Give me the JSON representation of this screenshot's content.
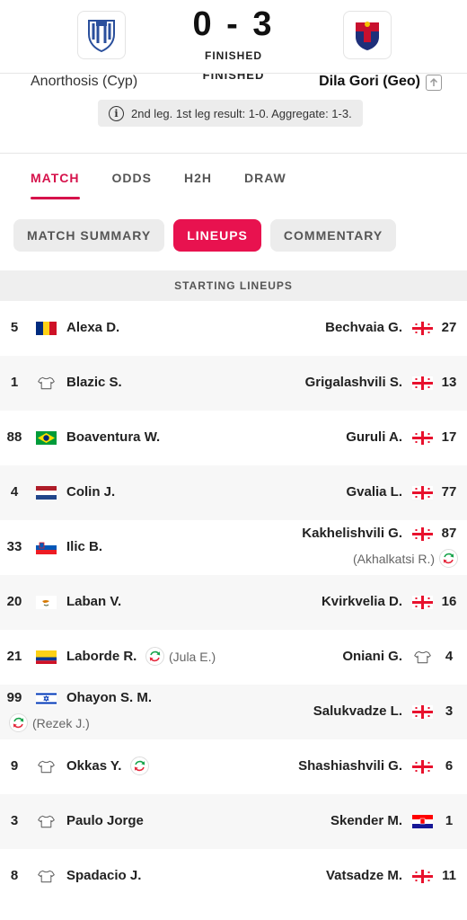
{
  "match": {
    "score": "0 - 3",
    "status": "FINISHED",
    "home_team": "Anorthosis (Cyp)",
    "away_team": "Dila Gori (Geo)",
    "info": "2nd leg. 1st leg result: 1-0. Aggregate: 1-3."
  },
  "tabs": [
    "MATCH",
    "ODDS",
    "H2H",
    "DRAW"
  ],
  "subtabs": [
    "MATCH SUMMARY",
    "LINEUPS",
    "COMMENTARY"
  ],
  "section_title": "STARTING LINEUPS",
  "colors": {
    "accent": "#d6124b",
    "accent_bg": "#e8124f",
    "row_alt": "#f7f7f7"
  },
  "home_lineup": [
    {
      "number": "5",
      "name": "Alexa D.",
      "flag": "romania-flag"
    },
    {
      "number": "1",
      "name": "Blazic S.",
      "flag": "jersey-icon"
    },
    {
      "number": "88",
      "name": "Boaventura W.",
      "flag": "brazil-flag"
    },
    {
      "number": "4",
      "name": "Colin J.",
      "flag": "netherlands-flag"
    },
    {
      "number": "33",
      "name": "Ilic B.",
      "flag": "slovenia-flag"
    },
    {
      "number": "20",
      "name": "Laban V.",
      "flag": "cyprus-flag"
    },
    {
      "number": "21",
      "name": "Laborde R.",
      "flag": "colombia-flag",
      "sub": "(Jula E.)"
    },
    {
      "number": "99",
      "name": "Ohayon S. M.",
      "flag": "israel-flag",
      "sub": "(Rezek J.)"
    },
    {
      "number": "9",
      "name": "Okkas Y.",
      "flag": "jersey-icon",
      "swap": true
    },
    {
      "number": "3",
      "name": "Paulo Jorge",
      "flag": "jersey-icon"
    },
    {
      "number": "8",
      "name": "Spadacio J.",
      "flag": "jersey-icon"
    }
  ],
  "away_lineup": [
    {
      "number": "27",
      "name": "Bechvaia G.",
      "flag": "georgia-flag"
    },
    {
      "number": "13",
      "name": "Grigalashvili S.",
      "flag": "georgia-flag"
    },
    {
      "number": "17",
      "name": "Guruli A.",
      "flag": "georgia-flag"
    },
    {
      "number": "77",
      "name": "Gvalia L.",
      "flag": "georgia-flag"
    },
    {
      "number": "87",
      "name": "Kakhelishvili G.",
      "flag": "georgia-flag",
      "sub": "(Akhalkatsi R.)"
    },
    {
      "number": "16",
      "name": "Kvirkvelia D.",
      "flag": "georgia-flag"
    },
    {
      "number": "4",
      "name": "Oniani G.",
      "flag": "jersey-icon"
    },
    {
      "number": "3",
      "name": "Salukvadze L.",
      "flag": "georgia-flag"
    },
    {
      "number": "6",
      "name": "Shashiashvili G.",
      "flag": "georgia-flag"
    },
    {
      "number": "1",
      "name": "Skender M.",
      "flag": "croatia-flag"
    },
    {
      "number": "11",
      "name": "Vatsadze M.",
      "flag": "georgia-flag"
    }
  ]
}
